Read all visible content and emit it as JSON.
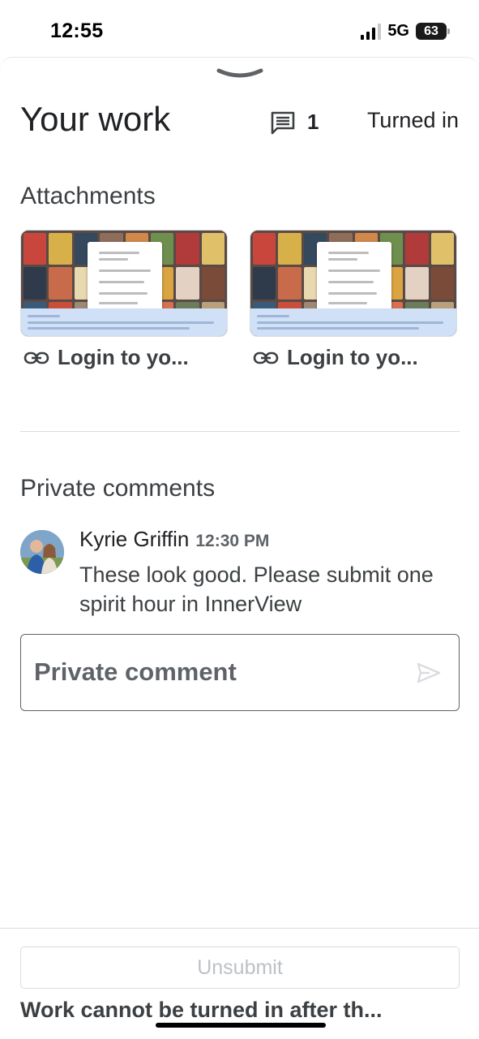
{
  "status_bar": {
    "time": "12:55",
    "network": "5G",
    "battery": "63",
    "signal_bars_active": 3,
    "signal_bars_total": 4
  },
  "header": {
    "title": "Your work",
    "comment_count": "1",
    "status": "Turned in"
  },
  "attachments": {
    "heading": "Attachments",
    "items": [
      {
        "label": "Login to yo...",
        "icon": "link-icon"
      },
      {
        "label": "Login to yo...",
        "icon": "link-icon"
      }
    ]
  },
  "private_comments": {
    "heading": "Private comments",
    "comments": [
      {
        "author": "Kyrie Griffin",
        "time": "12:30 PM",
        "text": "These look good. Please submit one spirit hour in InnerView"
      }
    ],
    "input_placeholder": "Private comment"
  },
  "footer": {
    "unsubmit_label": "Unsubmit",
    "note": "Work cannot be turned in after th..."
  },
  "colors": {
    "text_primary": "#202124",
    "text_secondary": "#3c4043",
    "muted": "#5f6368",
    "disabled": "#bdc1c6",
    "divider": "#dadce0"
  }
}
